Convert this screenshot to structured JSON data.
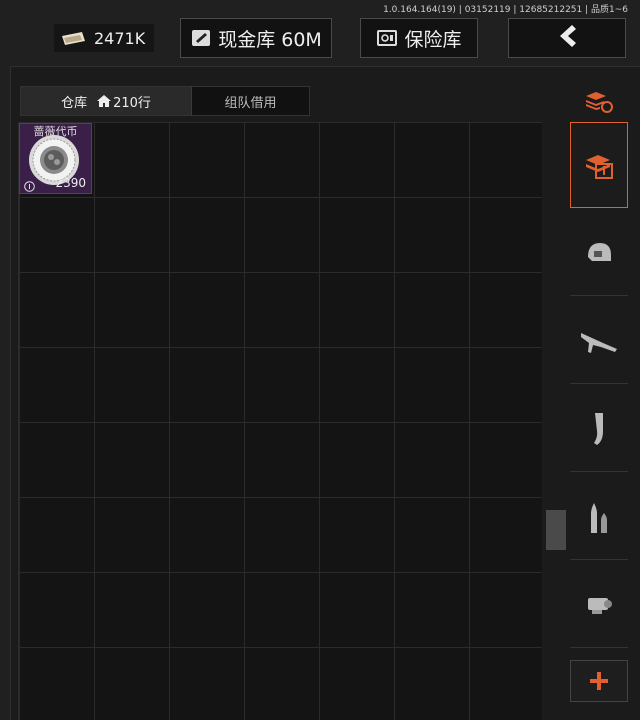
{
  "version": "1.0.164.164(19) | 03152119 | 12685212251 | 品质1~6",
  "header": {
    "money": "2471K",
    "cash_vault_label": "现金库 60M",
    "safe_label": "保险库",
    "back_icon": "chevron-left-icon"
  },
  "tabs": {
    "warehouse_label": "仓库",
    "rows": "210行",
    "team_borrow_label": "组队借用"
  },
  "items": [
    {
      "name": "蔷薇代币",
      "count": "2390",
      "rarity_color": "#3a1f48"
    }
  ],
  "sidebar": {
    "accent": "#e06030",
    "icons": [
      "stack-refresh-icon",
      "stack-download-icon",
      "helmet-icon",
      "rifle-icon",
      "magazine-icon",
      "ammo-icon",
      "scope-icon",
      "plus-icon"
    ]
  }
}
